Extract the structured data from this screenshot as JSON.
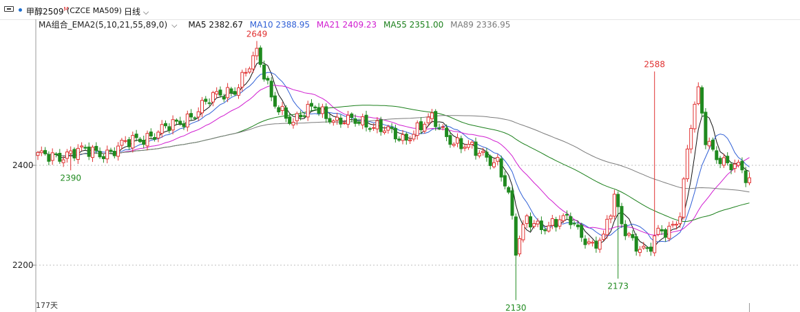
{
  "header": {
    "symbol": "甲醇2509",
    "symbol_sup": "M",
    "contract": "(CZCE MA509)",
    "period": "日线",
    "period_dropdown_icon": "chevron-down-icon"
  },
  "legend": {
    "indicator": "MA组合_EMA2(5,10,21,55,89,0)",
    "indicator_dropdown_icon": "chevron-down-icon",
    "items": [
      {
        "label": "MA5 2382.67",
        "color": "#111111"
      },
      {
        "label": "MA10 2388.95",
        "color": "#2f5fd6"
      },
      {
        "label": "MA21 2409.23",
        "color": "#d01bd0"
      },
      {
        "label": "MA55 2351.00",
        "color": "#1a7f1a"
      },
      {
        "label": "MA89 2336.95",
        "color": "#7a7a7a"
      }
    ]
  },
  "footer": {
    "days": "177天"
  },
  "colors": {
    "up": "#e03030",
    "down": "#1f8a1f",
    "grid": "#bdbdbd"
  },
  "chart_data": {
    "type": "candlestick",
    "ylim": [
      2130,
      2720
    ],
    "y_ticks": [
      2200,
      2400
    ],
    "y_tick_labels": [
      "2200",
      "2400"
    ],
    "annotations": [
      {
        "label": "2649",
        "value": 2649,
        "index": 60,
        "kind": "high"
      },
      {
        "label": "2390",
        "value": 2390,
        "index": 9,
        "kind": "low"
      },
      {
        "label": "2130",
        "value": 2130,
        "index": 131,
        "kind": "low"
      },
      {
        "label": "2173",
        "value": 2173,
        "index": 159,
        "kind": "low"
      },
      {
        "label": "2588",
        "value": 2588,
        "index": 169,
        "kind": "high"
      }
    ],
    "anchors": [
      [
        0,
        2415
      ],
      [
        9,
        2425
      ],
      [
        20,
        2428
      ],
      [
        30,
        2460
      ],
      [
        38,
        2480
      ],
      [
        46,
        2525
      ],
      [
        54,
        2555
      ],
      [
        60,
        2620
      ],
      [
        64,
        2540
      ],
      [
        70,
        2480
      ],
      [
        76,
        2525
      ],
      [
        82,
        2480
      ],
      [
        88,
        2495
      ],
      [
        94,
        2470
      ],
      [
        100,
        2455
      ],
      [
        108,
        2490
      ],
      [
        114,
        2450
      ],
      [
        120,
        2425
      ],
      [
        126,
        2410
      ],
      [
        129,
        2340
      ],
      [
        131,
        2225
      ],
      [
        134,
        2295
      ],
      [
        140,
        2275
      ],
      [
        146,
        2295
      ],
      [
        152,
        2235
      ],
      [
        155,
        2250
      ],
      [
        158,
        2340
      ],
      [
        160,
        2290
      ],
      [
        164,
        2235
      ],
      [
        167,
        2220
      ],
      [
        170,
        2270
      ],
      [
        174,
        2280
      ],
      [
        176,
        2300
      ],
      [
        179,
        2480
      ],
      [
        181,
        2550
      ],
      [
        183,
        2460
      ],
      [
        186,
        2420
      ],
      [
        189,
        2395
      ],
      [
        192,
        2395
      ],
      [
        195,
        2375
      ]
    ],
    "last_candle": {
      "open": 2365,
      "close": 2375,
      "high": 2386,
      "low": 2360
    },
    "ma_series": [
      {
        "name": "MA5",
        "period": 5,
        "color": "#111111",
        "last": 2382.67
      },
      {
        "name": "MA10",
        "period": 10,
        "color": "#2f5fd6",
        "last": 2388.95
      },
      {
        "name": "MA21",
        "period": 21,
        "color": "#d01bd0",
        "last": 2409.23
      },
      {
        "name": "MA55",
        "period": 55,
        "color": "#1a7f1a",
        "last": 2351.0
      },
      {
        "name": "MA89",
        "period": 89,
        "color": "#7a7a7a",
        "last": 2336.95
      }
    ]
  }
}
